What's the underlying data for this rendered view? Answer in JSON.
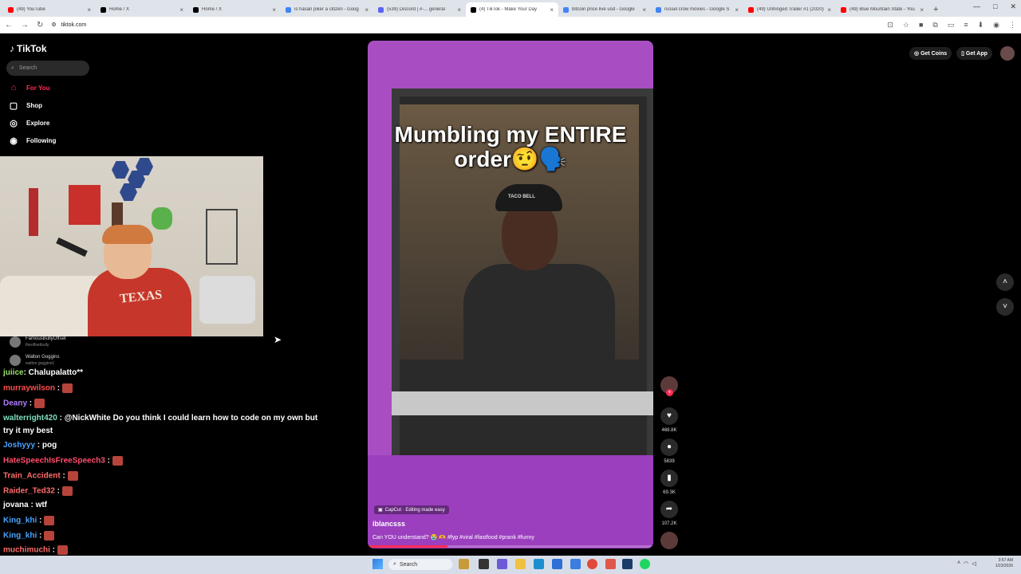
{
  "browser": {
    "tabs": [
      {
        "title": "(49) YouTube",
        "color": "#ff0000"
      },
      {
        "title": "Home / X",
        "color": "#000000"
      },
      {
        "title": "Home / X",
        "color": "#000000"
      },
      {
        "title": "is hasan piker a citizen - Goog",
        "color": "#4285f4"
      },
      {
        "title": "(539) Discord | #-... general",
        "color": "#5865f2"
      },
      {
        "title": "(4) TikTok - Make Your Day",
        "color": "#000000",
        "active": true
      },
      {
        "title": "bitcoin price live usd - Google",
        "color": "#4285f4"
      },
      {
        "title": "russel crow movies - Google S",
        "color": "#4285f4"
      },
      {
        "title": "(49) Unhinged Trailer #1 (2020)",
        "color": "#ff0000"
      },
      {
        "title": "(49) Blue Mountain State - You",
        "color": "#ff0000"
      }
    ],
    "url": "tiktok.com",
    "new_tab": "+"
  },
  "tiktok": {
    "logo": "TikTok",
    "search_placeholder": "Search",
    "nav": [
      {
        "label": "For You",
        "icon": "home-icon",
        "color": "#fe2c55"
      },
      {
        "label": "Shop",
        "icon": "shop-icon",
        "color": "#ffffff"
      },
      {
        "label": "Explore",
        "icon": "explore-icon",
        "color": "#ffffff"
      },
      {
        "label": "Following",
        "icon": "following-icon",
        "color": "#ffffff"
      }
    ],
    "following": [
      {
        "name": "FamousBullyOffset",
        "handle": "theoffsetbully"
      },
      {
        "name": "Walton Goggins",
        "handle": "walton.goggins1"
      }
    ],
    "get_coins": "Get Coins",
    "get_app": "Get App"
  },
  "video": {
    "caption": "Mumbling my ENTIRE order🤨🗣️",
    "cap_text": "TACO BELL",
    "capcut": "CapCut · Editing made easy",
    "author": "iblancsss",
    "description": "Can YOU understand? 😭 🫶 #fyp #viral #fastfood #prank #funny",
    "progress": 0.28,
    "likes": "468.8K",
    "comments": "5839",
    "saves": "69.3K",
    "shares": "107.2K"
  },
  "chat": [
    {
      "user": "juiice",
      "color": "#9be36a",
      "text": ": Chalupalatto**",
      "emote": false
    },
    {
      "user": "murraywilson",
      "color": "#ff4d4d",
      "text": " :",
      "emote": true
    },
    {
      "user": "Deany",
      "color": "#b07bff",
      "text": " :",
      "emote": true
    },
    {
      "user": "walterright420",
      "color": "#7ee0c0",
      "text": " : @NickWhite Do you think I could learn how to code on my own but",
      "emote": false
    },
    {
      "user": "",
      "color": "#ffffff",
      "text": "try it my best",
      "emote": false
    },
    {
      "user": "Joshyyy",
      "color": "#4aa3ff",
      "text": " : pog",
      "emote": false
    },
    {
      "user": "HateSpeechIsFreeSpeech3",
      "color": "#ff4d6d",
      "text": " :",
      "emote": true
    },
    {
      "user": "Train_Accident",
      "color": "#ff6b6b",
      "text": " :",
      "emote": true
    },
    {
      "user": "Raider_Ted32",
      "color": "#ff6b6b",
      "text": " :",
      "emote": true
    },
    {
      "user": "jovana",
      "color": "#ffffff",
      "text": " : wtf",
      "emote": false
    },
    {
      "user": "King_khi",
      "color": "#4aa3ff",
      "text": " :",
      "emote": true
    },
    {
      "user": "King_khi",
      "color": "#4aa3ff",
      "text": " :",
      "emote": true
    },
    {
      "user": "muchimuchi",
      "color": "#ff6b6b",
      "text": " :",
      "emote": true
    }
  ],
  "cam": {
    "shirt": "TEXAS"
  },
  "taskbar": {
    "search": "Search",
    "time": "3:57 AM",
    "date": "1/23/2026"
  }
}
